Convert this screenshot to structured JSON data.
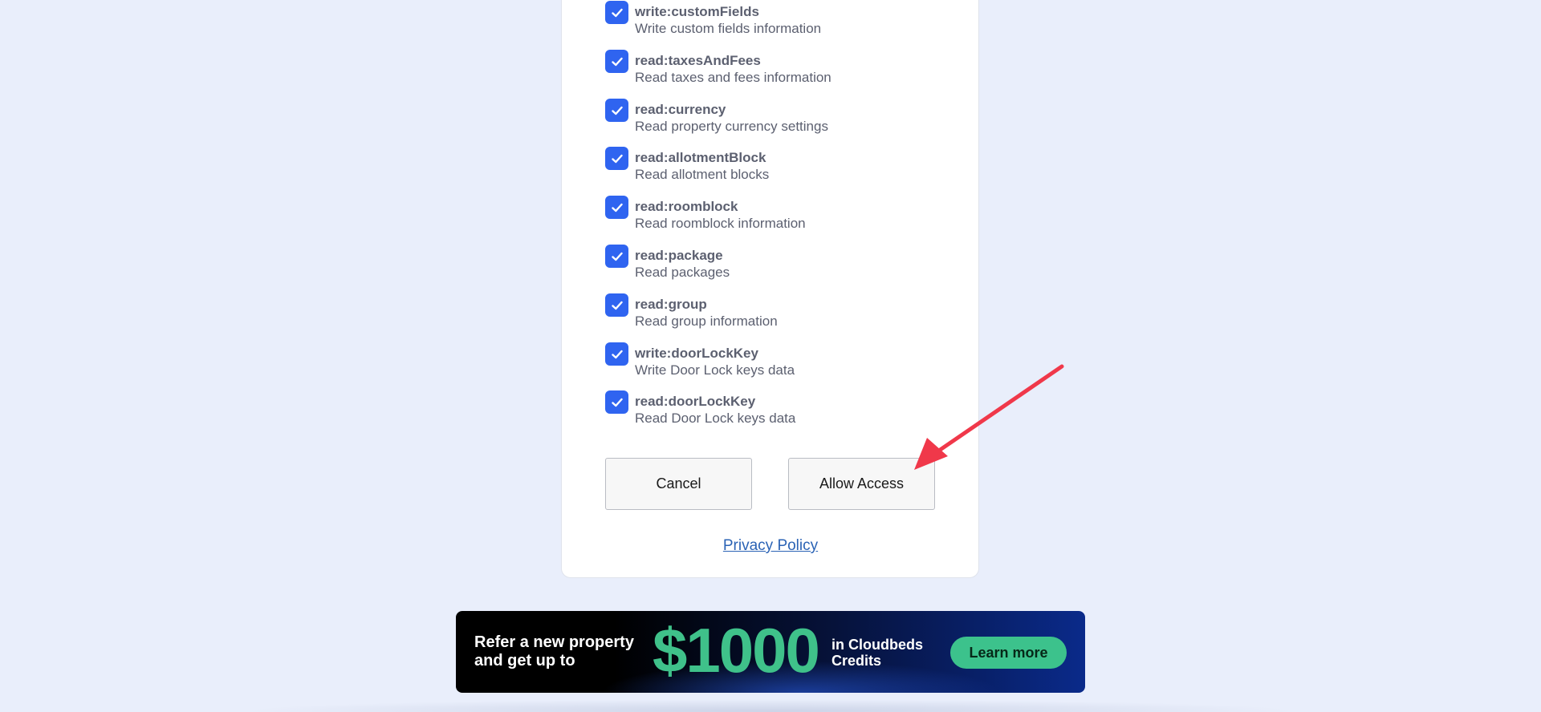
{
  "scopes": [
    {
      "name": "write:customFields",
      "description": "Write custom fields information",
      "checked": true
    },
    {
      "name": "read:taxesAndFees",
      "description": "Read taxes and fees information",
      "checked": true
    },
    {
      "name": "read:currency",
      "description": "Read property currency settings",
      "checked": true
    },
    {
      "name": "read:allotmentBlock",
      "description": "Read allotment blocks",
      "checked": true
    },
    {
      "name": "read:roomblock",
      "description": "Read roomblock information",
      "checked": true
    },
    {
      "name": "read:package",
      "description": "Read packages",
      "checked": true
    },
    {
      "name": "read:group",
      "description": "Read group information",
      "checked": true
    },
    {
      "name": "write:doorLockKey",
      "description": "Write Door Lock keys data",
      "checked": true
    },
    {
      "name": "read:doorLockKey",
      "description": "Read Door Lock keys data",
      "checked": true
    }
  ],
  "actions": {
    "cancel_label": "Cancel",
    "allow_label": "Allow Access"
  },
  "privacy_link": "Privacy Policy",
  "banner": {
    "left_text": "Refer a new property and get up to",
    "amount": "$1000",
    "credits_text": "in Cloudbeds Credits",
    "button_label": "Learn more"
  },
  "colors": {
    "background": "#e9eefb",
    "checkbox": "#2f64f0",
    "link": "#2b63b5",
    "annotation_arrow": "#f0384a",
    "banner_accent": "#3fc18a"
  },
  "icons": {
    "checkbox": "checkmark-icon",
    "annotation": "red-arrow"
  }
}
